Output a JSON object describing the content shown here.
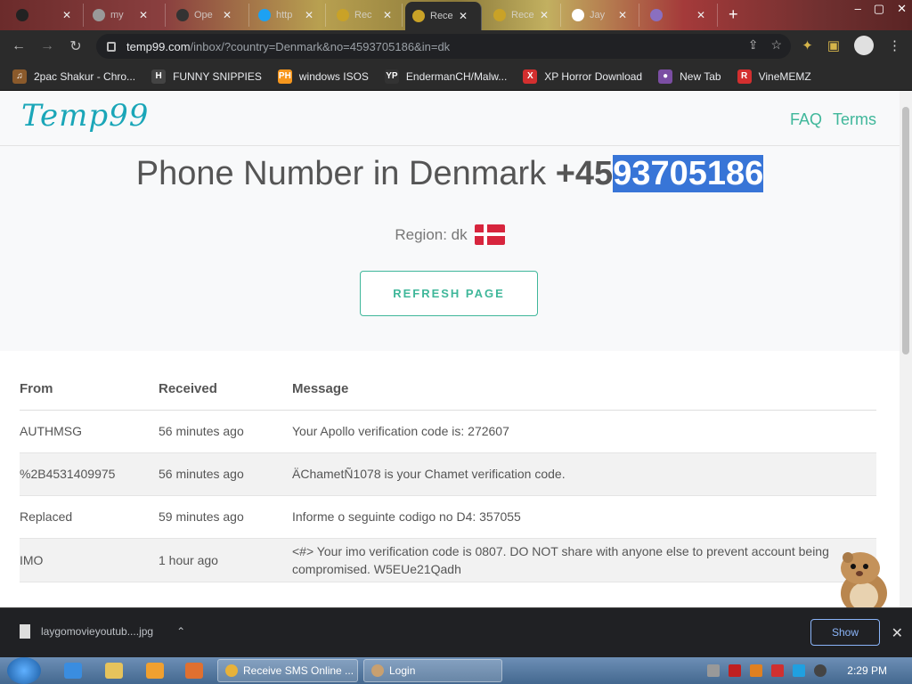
{
  "browser": {
    "tabs": [
      {
        "label": ""
      },
      {
        "label": "my"
      },
      {
        "label": "Ope"
      },
      {
        "label": "http"
      },
      {
        "label": "Rec"
      },
      {
        "label": "Rece",
        "active": true
      },
      {
        "label": "Rece"
      },
      {
        "label": "Jay"
      },
      {
        "label": ""
      }
    ],
    "url_host": "temp99.com",
    "url_path": "/inbox/?country=Denmark&no=4593705186&in=dk"
  },
  "bookmarks": [
    {
      "label": "2pac Shakur - Chro...",
      "icon": "2pac-icon",
      "color": "#8b5a2b",
      "glyph": "♫"
    },
    {
      "label": "FUNNY SNIPPIES",
      "icon": "h-icon",
      "color": "#444444",
      "glyph": "H"
    },
    {
      "label": "windows ISOS",
      "icon": "ph-icon",
      "color": "#f7971d",
      "glyph": "PH"
    },
    {
      "label": "EndermanCH/Malw...",
      "icon": "yp-icon",
      "color": "#333333",
      "glyph": "YP"
    },
    {
      "label": "XP Horror Download",
      "icon": "x-icon",
      "color": "#d32f2f",
      "glyph": "X"
    },
    {
      "label": "New Tab",
      "icon": "newtab-icon",
      "color": "#7b4ea3",
      "glyph": "●"
    },
    {
      "label": "VineMEMZ",
      "icon": "r-icon",
      "color": "#d32f2f",
      "glyph": "R"
    }
  ],
  "site": {
    "logo": "Temp99",
    "nav": [
      "FAQ",
      "Terms"
    ],
    "heading_prefix": "Phone Number in Denmark",
    "number_plain": "+45",
    "number_selected": "93705186",
    "region": "Region: dk",
    "refresh": "REFRESH PAGE"
  },
  "table": {
    "headers": [
      "From",
      "Received",
      "Message"
    ],
    "rows": [
      {
        "from": "AUTHMSG",
        "received": "56 minutes ago",
        "message": "Your Apollo verification code is: 272607"
      },
      {
        "from": "%2B4531409975",
        "received": "56 minutes ago",
        "message": "ÄChametÑ1078 is your Chamet verification code."
      },
      {
        "from": "Replaced",
        "received": "59 minutes ago",
        "message": "Informe o seguinte codigo no D4: 357055"
      },
      {
        "from": "IMO",
        "received": "1 hour ago",
        "message": "<#> Your imo verification code is 0807. DO NOT share with anyone else to prevent account being compromised. W5EUe21Qadh"
      }
    ]
  },
  "download": {
    "filename": "laygomovieyoutub....jpg",
    "show_all": "Show"
  },
  "taskbar": {
    "tasks": [
      "Receive SMS Online ...",
      "Login"
    ],
    "clock": "2:29 PM"
  },
  "colors": {
    "accent_green": "#3fb79a",
    "logo_teal": "#1aa6b8",
    "selection_blue": "#3875d7"
  }
}
